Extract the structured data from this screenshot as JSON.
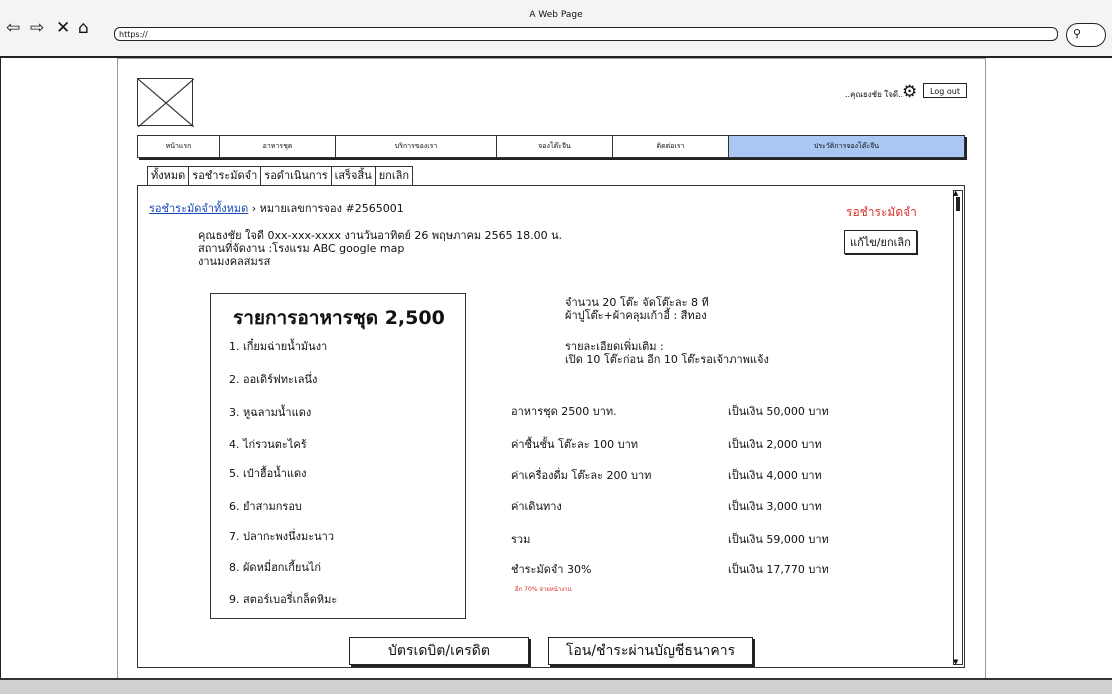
{
  "browser": {
    "title": "A Web Page",
    "url": "https://",
    "search_icon": "search-icon"
  },
  "header": {
    "user_name": "..คุณธงชัย ใจดี..",
    "settings_icon": "gear-icon",
    "logout_label": "Log out"
  },
  "nav": {
    "items": [
      "หน้าแรก",
      "อาหารชุด",
      "บริการของเรา",
      "จองโต๊ะจีน",
      "ติดต่อเรา",
      "ประวัติการจองโต๊ะจีน"
    ],
    "active_color": "#a9c7f2"
  },
  "tabs": [
    "ทั้งหมด",
    "รอชำระมัดจำ",
    "รอดำเนินการ",
    "เสร็จสิ้น",
    "ยกเลิก"
  ],
  "breadcrumb": {
    "link": "รอชำระมัดจำทั้งหมด",
    "separator": " › ",
    "current": "หมายเลขการจอง #2565001"
  },
  "order": {
    "status": "รอชำระมัดจำ",
    "status_color": "#d9312a",
    "edit_label": "แก้ไข/ยกเลิก",
    "customer_line": "คุณธงชัย ใจดี 0xx-xxx-xxxx งานวันอาทิตย์ 26 พฤษภาคม 2565 18.00 น.",
    "venue_line": "สถานที่จัดงาน :โรงแรม ABC google map",
    "event_type": "งานมงคลสมรส"
  },
  "menu": {
    "title": "รายการอาหารชุด 2,500",
    "items": [
      "1. เกี๋ยมฉ่ายน้ำมันงา",
      "2. ออเดิร์ฟทะเลนึ่ง",
      "3. หูฉลามน้ำแดง",
      "4. ไก่รวนตะไคร้",
      "5. เป๋าฮื้อน้ำแดง",
      "6. ยำสามกรอบ",
      "7. ปลากะพงนึ่งมะนาว",
      "8. ผัดหมี่ฮกเกี้ยนไก่",
      "9. สตอร์เบอรี่เกล็ดหิมะ"
    ]
  },
  "details": {
    "tables_line": "จำนวน 20 โต๊ะ จัดโต๊ะละ 8 ที",
    "cloth_line": "ผ้าปูโต๊ะ+ผ้าคลุมเก้าอี้ : สีทอง",
    "more_label": "รายละเอียดเพิ่มเติม :",
    "more_text": "เปิด 10 โต๊ะก่อน อีก 10 โต๊ะรอเจ้าภาพแจ้ง"
  },
  "costs": [
    {
      "label": "อาหารชุด 2500 บาท.",
      "amount": "เป็นเงิน 50,000 บาท"
    },
    {
      "label": "ค่าชื้นชั้น โต๊ะละ 100 บาท",
      "amount": "เป็นเงิน 2,000 บาท"
    },
    {
      "label": "ค่าเครื่องดื่ม โต๊ะละ 200 บาท",
      "amount": "เป็นเงิน 4,000 บาท"
    },
    {
      "label": "ค่าเดินทาง",
      "amount": "เป็นเงิน 3,000 บาท"
    },
    {
      "label": "รวม",
      "amount": "เป็นเงิน 59,000 บาท"
    },
    {
      "label": "ชำระมัดจำ 30%",
      "amount": "เป็นเงิน 17,770 บาท"
    }
  ],
  "remaining_note": "อีก 70% จ่ายหน้างาน",
  "payment": {
    "card_label": "บัตรเดบิต/เครดิต",
    "bank_label": "โอน/ชำระผ่านบัญชีธนาคาร"
  }
}
